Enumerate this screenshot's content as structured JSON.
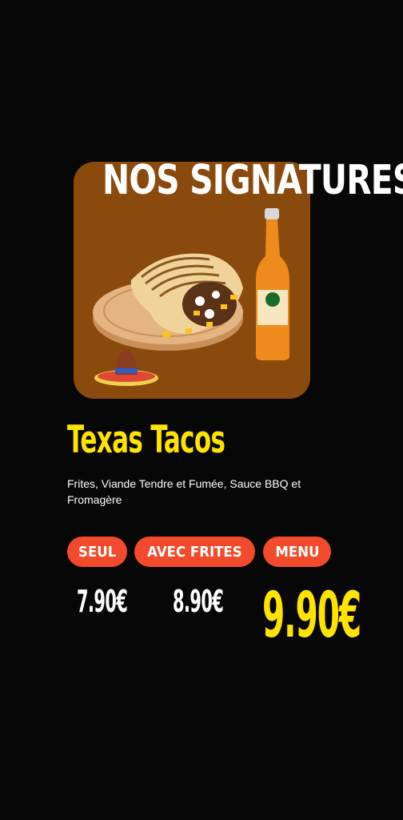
{
  "header": {
    "title": "NOS SIGNATURES"
  },
  "product": {
    "name": "Texas Tacos",
    "description": "Frites, Viande Tendre et Fumée, Sauce BBQ et Fromagère"
  },
  "options": [
    {
      "label": "SEUL",
      "price": "7.90€"
    },
    {
      "label": "AVEC FRITES",
      "price": "8.90€"
    },
    {
      "label": "MENU",
      "price": "9.90€"
    }
  ],
  "colors": {
    "background": "#070707",
    "hero": "#8a4a0e",
    "accent_yellow": "#ffe400",
    "pill_red": "#f24a2c"
  },
  "icons": [
    "tacos-illustration",
    "soda-bottle-icon",
    "sombrero-icon"
  ]
}
